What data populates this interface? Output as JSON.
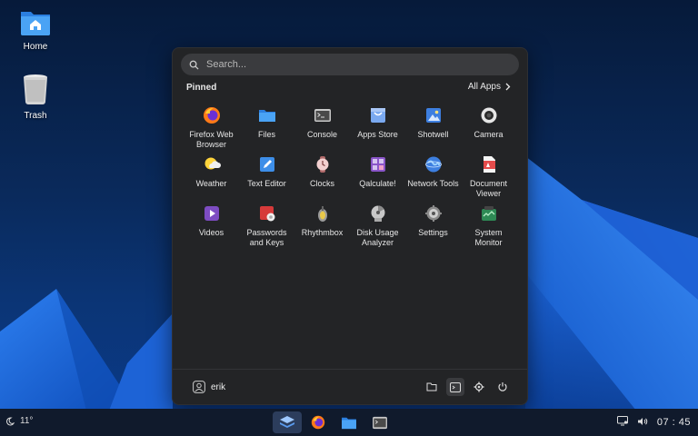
{
  "desktop": {
    "icons": [
      {
        "label": "Home"
      },
      {
        "label": "Trash"
      }
    ]
  },
  "menu": {
    "search_placeholder": "Search...",
    "pinned_label": "Pinned",
    "all_apps_label": "All Apps",
    "apps": [
      {
        "name": "Firefox Web Browser",
        "icon": "firefox-icon"
      },
      {
        "name": "Files",
        "icon": "folder-icon"
      },
      {
        "name": "Console",
        "icon": "terminal-icon"
      },
      {
        "name": "Apps Store",
        "icon": "store-icon"
      },
      {
        "name": "Shotwell",
        "icon": "photo-icon"
      },
      {
        "name": "Camera",
        "icon": "camera-icon"
      },
      {
        "name": "Weather",
        "icon": "weather-icon"
      },
      {
        "name": "Text Editor",
        "icon": "text-editor-icon"
      },
      {
        "name": "Clocks",
        "icon": "clock-icon"
      },
      {
        "name": "Qalculate!",
        "icon": "calculator-icon"
      },
      {
        "name": "Network Tools",
        "icon": "network-icon"
      },
      {
        "name": "Document Viewer",
        "icon": "document-icon"
      },
      {
        "name": "Videos",
        "icon": "video-icon"
      },
      {
        "name": "Passwords and Keys",
        "icon": "keys-icon"
      },
      {
        "name": "Rhythmbox",
        "icon": "music-icon"
      },
      {
        "name": "Disk Usage Analyzer",
        "icon": "disk-icon"
      },
      {
        "name": "Settings",
        "icon": "settings-icon"
      },
      {
        "name": "System Monitor",
        "icon": "monitor-icon"
      }
    ],
    "user_name": "erik"
  },
  "taskbar": {
    "weather_temp": "11°",
    "clock": "07 : 45"
  },
  "colors": {
    "accent": "#3d8ee8",
    "menu_bg": "#232426",
    "taskbar_bg": "#101a2c"
  }
}
